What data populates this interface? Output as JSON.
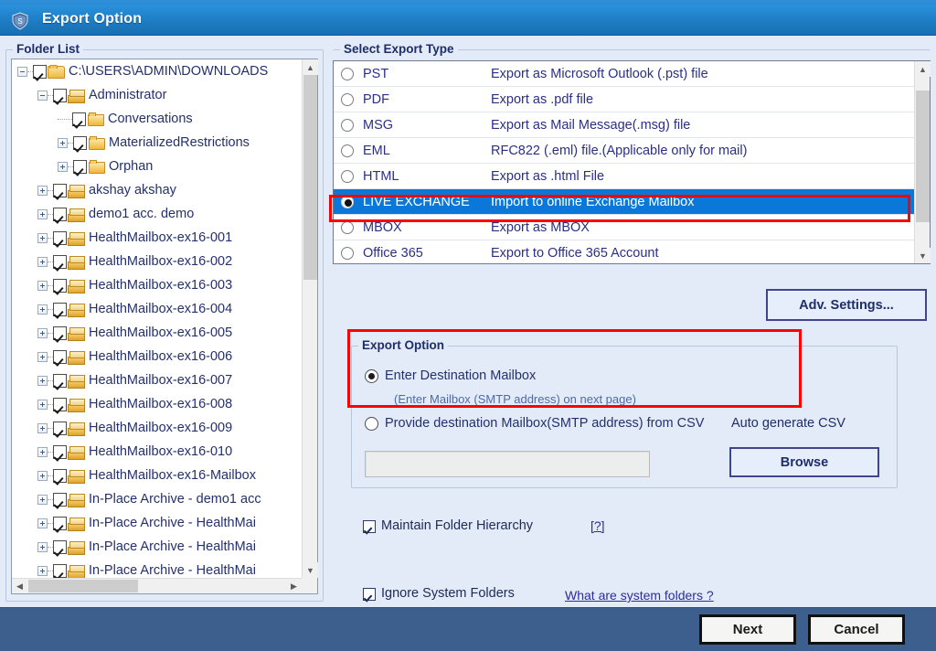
{
  "window": {
    "title": "Export Option",
    "icon": "app-shield-icon"
  },
  "colors": {
    "titlebar": "#1d7cc4",
    "panel_bg": "#e3ebf9",
    "footer": "#3c5f8e",
    "selection_blue": "#0b78d9",
    "highlight_red": "#fb0000",
    "label_navy": "#1f2d6b"
  },
  "folder_list": {
    "label": "Folder List",
    "items": [
      {
        "label": "C:\\USERS\\ADMIN\\DOWNLOADS",
        "indent": 0,
        "expander": "minus",
        "checked": true,
        "icon": "folder-open-icon"
      },
      {
        "label": "Administrator",
        "indent": 1,
        "expander": "minus",
        "checked": true,
        "icon": "mailbox-icon"
      },
      {
        "label": "Conversations",
        "indent": 2,
        "expander": "none",
        "checked": true,
        "icon": "folder-icon"
      },
      {
        "label": "MaterializedRestrictions",
        "indent": 2,
        "expander": "plus",
        "checked": true,
        "icon": "folder-icon"
      },
      {
        "label": "Orphan",
        "indent": 2,
        "expander": "plus",
        "checked": true,
        "icon": "folder-icon"
      },
      {
        "label": "akshay akshay",
        "indent": 1,
        "expander": "plus",
        "checked": true,
        "icon": "mailbox-icon"
      },
      {
        "label": "demo1 acc. demo",
        "indent": 1,
        "expander": "plus",
        "checked": true,
        "icon": "mailbox-icon"
      },
      {
        "label": "HealthMailbox-ex16-001",
        "indent": 1,
        "expander": "plus",
        "checked": true,
        "icon": "mailbox-icon"
      },
      {
        "label": "HealthMailbox-ex16-002",
        "indent": 1,
        "expander": "plus",
        "checked": true,
        "icon": "mailbox-icon"
      },
      {
        "label": "HealthMailbox-ex16-003",
        "indent": 1,
        "expander": "plus",
        "checked": true,
        "icon": "mailbox-icon"
      },
      {
        "label": "HealthMailbox-ex16-004",
        "indent": 1,
        "expander": "plus",
        "checked": true,
        "icon": "mailbox-icon"
      },
      {
        "label": "HealthMailbox-ex16-005",
        "indent": 1,
        "expander": "plus",
        "checked": true,
        "icon": "mailbox-icon"
      },
      {
        "label": "HealthMailbox-ex16-006",
        "indent": 1,
        "expander": "plus",
        "checked": true,
        "icon": "mailbox-icon"
      },
      {
        "label": "HealthMailbox-ex16-007",
        "indent": 1,
        "expander": "plus",
        "checked": true,
        "icon": "mailbox-icon"
      },
      {
        "label": "HealthMailbox-ex16-008",
        "indent": 1,
        "expander": "plus",
        "checked": true,
        "icon": "mailbox-icon"
      },
      {
        "label": "HealthMailbox-ex16-009",
        "indent": 1,
        "expander": "plus",
        "checked": true,
        "icon": "mailbox-icon"
      },
      {
        "label": "HealthMailbox-ex16-010",
        "indent": 1,
        "expander": "plus",
        "checked": true,
        "icon": "mailbox-icon"
      },
      {
        "label": "HealthMailbox-ex16-Mailbox",
        "indent": 1,
        "expander": "plus",
        "checked": true,
        "icon": "mailbox-icon"
      },
      {
        "label": "In-Place Archive - demo1 acc",
        "indent": 1,
        "expander": "plus",
        "checked": true,
        "icon": "mailbox-icon"
      },
      {
        "label": "In-Place Archive - HealthMai",
        "indent": 1,
        "expander": "plus",
        "checked": true,
        "icon": "mailbox-icon"
      },
      {
        "label": "In-Place Archive - HealthMai",
        "indent": 1,
        "expander": "plus",
        "checked": true,
        "icon": "mailbox-icon"
      },
      {
        "label": "In-Place Archive - HealthMai",
        "indent": 1,
        "expander": "plus",
        "checked": true,
        "icon": "mailbox-icon"
      }
    ],
    "scroll": {
      "vertical_thumb_pct": 42,
      "horizontal_thumb_pct": 42,
      "up_arrow": "⌃",
      "down_arrow": "⌄",
      "left_arrow": "‹",
      "right_arrow": "›"
    }
  },
  "export_type": {
    "label": "Select Export Type",
    "rows": [
      {
        "code": "PST",
        "desc": "Export as Microsoft Outlook (.pst) file",
        "selected": false
      },
      {
        "code": "PDF",
        "desc": "Export as .pdf file",
        "selected": false
      },
      {
        "code": "MSG",
        "desc": "Export as Mail Message(.msg) file",
        "selected": false
      },
      {
        "code": "EML",
        "desc": "RFC822 (.eml) file.(Applicable only for mail)",
        "selected": false
      },
      {
        "code": "HTML",
        "desc": "Export as .html File",
        "selected": false
      },
      {
        "code": "LIVE EXCHANGE",
        "desc": "Import to online Exchange Mailbox",
        "selected": true
      },
      {
        "code": "MBOX",
        "desc": "Export as MBOX",
        "selected": false
      },
      {
        "code": "Office 365",
        "desc": "Export to Office 365 Account",
        "selected": false
      }
    ],
    "scroll": {
      "thumb_top_pct": 8,
      "thumb_height_pct": 76
    }
  },
  "adv_settings": {
    "label": "Adv. Settings..."
  },
  "export_option": {
    "label": "Export Option",
    "radio_enter_dest": {
      "label": "Enter Destination Mailbox",
      "sub": "(Enter Mailbox (SMTP address) on next page)",
      "selected": true
    },
    "radio_csv": {
      "label": "Provide destination Mailbox(SMTP address) from CSV",
      "selected": false
    },
    "auto_generate_csv": "Auto generate CSV",
    "csv_path_value": "",
    "csv_path_placeholder": "",
    "browse_label": "Browse"
  },
  "options": {
    "maintain_folder_hierarchy": {
      "label": "Maintain Folder Hierarchy",
      "checked": true,
      "help": "[?]"
    },
    "ignore_system_folders": {
      "label": "Ignore System Folders",
      "checked": true,
      "help": "What are system folders ?"
    }
  },
  "footer": {
    "next_label": "Next",
    "cancel_label": "Cancel"
  }
}
